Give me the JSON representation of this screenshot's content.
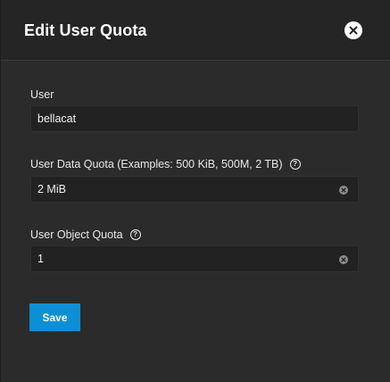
{
  "dialog": {
    "title": "Edit User Quota",
    "close_icon": "close-icon"
  },
  "fields": {
    "user": {
      "label": "User",
      "value": "bellacat"
    },
    "data_quota": {
      "label": "User Data Quota (Examples: 500 KiB, 500M, 2 TB)",
      "value": "2 MiB",
      "help_icon": "help-icon",
      "clear_icon": "clear-icon"
    },
    "object_quota": {
      "label": "User Object Quota",
      "value": "1",
      "help_icon": "help-icon",
      "clear_icon": "clear-icon"
    }
  },
  "actions": {
    "save_label": "Save"
  },
  "colors": {
    "background": "#2b2b2b",
    "header_background": "#252525",
    "input_background": "#222222",
    "accent": "#0d8fd6",
    "text": "#ffffff"
  }
}
